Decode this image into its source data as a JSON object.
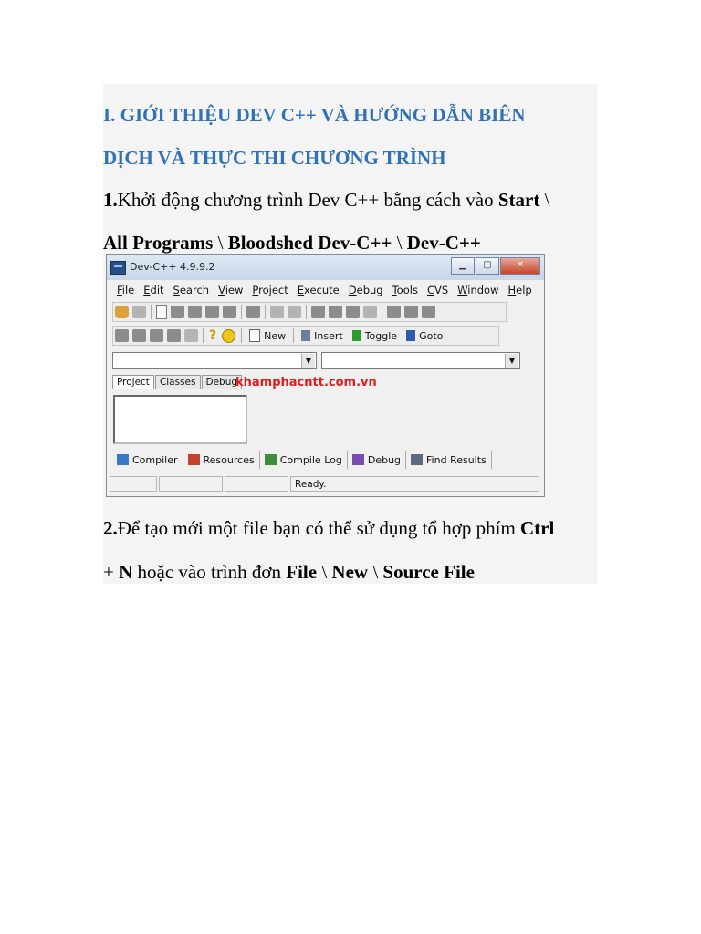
{
  "doc": {
    "heading_line1": "I. GIỚI THIỆU DEV C++ VÀ HƯỚNG DẪN BIÊN",
    "heading_line2": "DỊCH VÀ THỰC THI CHƯƠNG TRÌNH",
    "step1_num": "1.",
    "step1_text": "Khởi động chương trình Dev C++ bằng cách vào ",
    "step1_bold1": "Start",
    "step1_sep1": " \\",
    "step1_bold2": "All Programs",
    "step1_sep2": " \\ ",
    "step1_bold3": "Bloodshed Dev-C++",
    "step1_sep3": " \\ ",
    "step1_bold4": "Dev-C++",
    "step2_num": "2.",
    "step2_text": "Để tạo mới một file bạn có thể sử dụng tổ hợp phím ",
    "step2_bold1": "Ctrl",
    "step2_line2_pre": "+ ",
    "step2_bold2": "N",
    "step2_text2": " hoặc vào trình đơn ",
    "step2_bold3": "File",
    "step2_sep1": " \\ ",
    "step2_bold4": "New",
    "step2_sep2": " \\ ",
    "step2_bold5": "Source File"
  },
  "window": {
    "title": "Dev-C++ 4.9.9.2",
    "menu": [
      "File",
      "Edit",
      "Search",
      "View",
      "Project",
      "Execute",
      "Debug",
      "Tools",
      "CVS",
      "Window",
      "Help"
    ],
    "toolbar2": {
      "new_label": "New",
      "insert_label": "Insert",
      "toggle_label": "Toggle",
      "goto_label": "Goto"
    },
    "tabs": [
      "Project",
      "Classes",
      "Debug"
    ],
    "watermark": "khamphacntt.com.vn",
    "bottom_tabs": [
      "Compiler",
      "Resources",
      "Compile Log",
      "Debug",
      "Find Results"
    ],
    "status": "Ready.",
    "icon_colors": {
      "compiler": "#3a78c8",
      "resources": "#c8412e",
      "compile_log": "#3b8f3b",
      "debug": "#7a4bb0",
      "find": "#5b6b7d"
    }
  }
}
